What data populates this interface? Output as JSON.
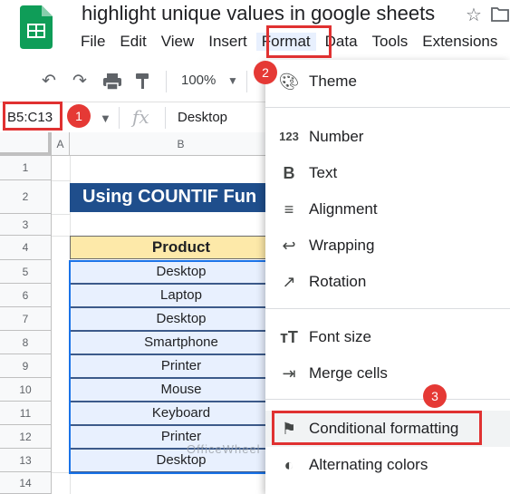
{
  "app": {
    "doc_title": "highlight unique values in google sheets",
    "star_icon": "star-icon",
    "move_icon": "folder-icon"
  },
  "menubar": [
    "File",
    "Edit",
    "View",
    "Insert",
    "Format",
    "Data",
    "Tools",
    "Extensions"
  ],
  "toolbar": {
    "zoom": "100%",
    "icons": [
      "undo-icon",
      "redo-icon",
      "print-icon"
    ]
  },
  "formula_bar": {
    "name_box": "B5:C13",
    "fx": "fx",
    "value": "Desktop"
  },
  "sheet": {
    "columns": [
      "A",
      "B"
    ],
    "rows": [
      "1",
      "2",
      "3",
      "4",
      "5",
      "6",
      "7",
      "8",
      "9",
      "10",
      "11",
      "12",
      "13",
      "14"
    ],
    "banner": "Using COUNTIF Fun",
    "header": "Product",
    "products": [
      "Desktop",
      "Laptop",
      "Desktop",
      "Smartphone",
      "Printer",
      "Mouse",
      "Keyboard",
      "Printer",
      "Desktop"
    ]
  },
  "format_menu": {
    "theme": "Theme",
    "number": "Number",
    "text": "Text",
    "alignment": "Alignment",
    "wrapping": "Wrapping",
    "rotation": "Rotation",
    "font_size": "Font size",
    "merge_cells": "Merge cells",
    "conditional_formatting": "Conditional formatting",
    "alternating_colors": "Alternating colors"
  },
  "annotations": {
    "step1": "1",
    "step2": "2",
    "step3": "3",
    "accent": "#e03131"
  },
  "watermark": "OfficeWheel"
}
